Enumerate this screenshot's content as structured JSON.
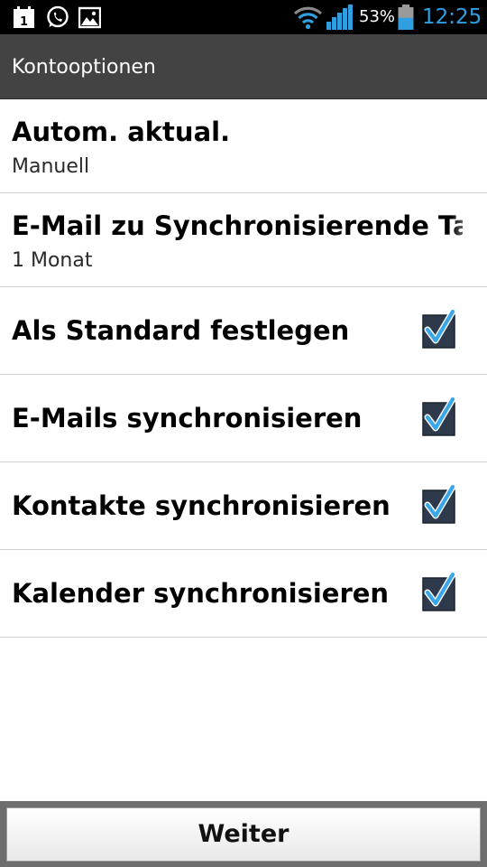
{
  "status_bar": {
    "icons": [
      "calendar-icon",
      "whatsapp-icon",
      "gallery-icon",
      "wifi-icon",
      "signal-icon",
      "battery-icon"
    ],
    "calendar_day": "1",
    "battery_percent": "53%",
    "battery_level": 0.53,
    "time": "12:25",
    "time_color": "#2f9fe0"
  },
  "action_bar": {
    "title": "Kontooptionen",
    "background": "#434343"
  },
  "settings": {
    "auto_update": {
      "title": "Autom. aktual.",
      "value": "Manuell"
    },
    "sync_period": {
      "title": "E-Mail zu Synchronisierende Tage",
      "value": "1 Monat"
    },
    "default_account": {
      "title": "Als Standard festlegen",
      "checked": true
    },
    "sync_email": {
      "title": "E-Mails synchronisieren",
      "checked": true
    },
    "sync_contacts": {
      "title": "Kontakte synchronisieren",
      "checked": true
    },
    "sync_calendar": {
      "title": "Kalender synchronisieren",
      "checked": true
    }
  },
  "checkbox_color": "#3aa8e8",
  "bottom": {
    "next_label": "Weiter"
  }
}
